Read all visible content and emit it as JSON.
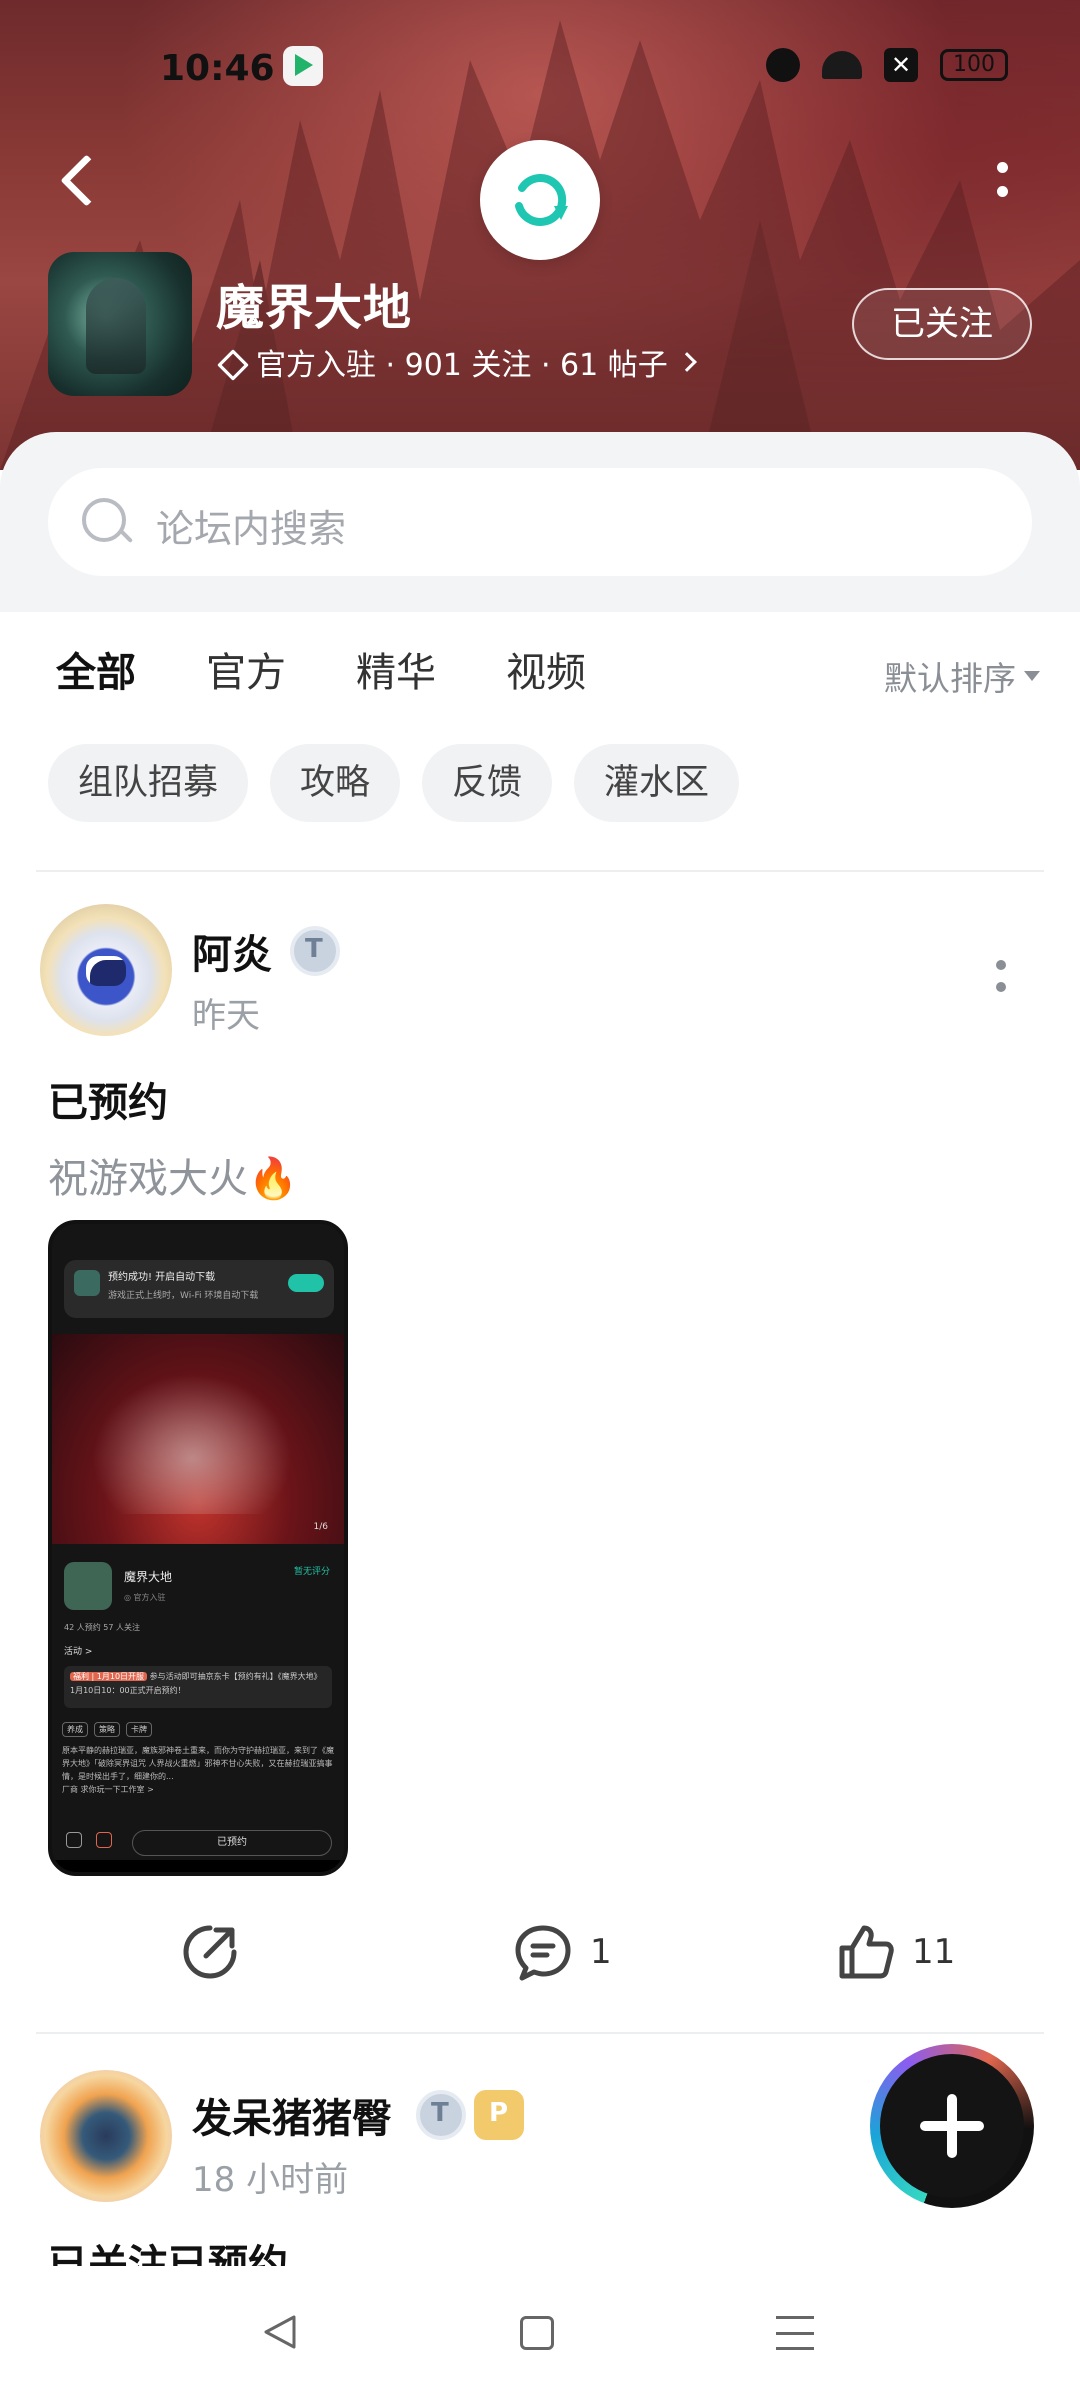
{
  "status_bar": {
    "time": "10:46",
    "battery": "100"
  },
  "forum": {
    "title": "魔界大地",
    "meta": "官方入驻 · 901 关注 · 61 帖子",
    "follow_label": "已关注"
  },
  "search": {
    "placeholder": "论坛内搜索"
  },
  "tabs": [
    {
      "label": "全部",
      "active": true
    },
    {
      "label": "官方"
    },
    {
      "label": "精华"
    },
    {
      "label": "视频"
    }
  ],
  "sort_label": "默认排序",
  "chips": [
    "组队招募",
    "攻略",
    "反馈",
    "灌水区"
  ],
  "posts": [
    {
      "author": "阿炎",
      "time": "昨天",
      "title": "已预约",
      "body": "祝游戏大火🔥",
      "comments": "1",
      "likes": "11",
      "screenshot": {
        "toast_title": "预约成功! 开启自动下载",
        "toast_sub": "游戏正式上线时，Wi-Fi 环境自动下载",
        "page_indicator": "1/6",
        "game_name": "魔界大地",
        "game_sub": "◎ 官方入驻",
        "score": "暂无评分",
        "stats": "42 人预约   57 人关注",
        "activity": "活动 >",
        "banner_tag": "福利 | 1月10日开服",
        "banner_text": "参与活动即可抽京东卡【预约有礼】《魔界大地》1月10日10：00正式开启预约！",
        "tags": [
          "养成",
          "策略",
          "卡牌"
        ],
        "desc": "原本平静的赫拉瑞亚，魔族邪神卷土重来，而你为守护赫拉瑞亚，来到了《魔界大地》「破除冥界诅咒 人界战火重燃」邪神不甘心失败，又在赫拉瑞亚搞事情，是时候出手了，细建你的...",
        "ad": "厂商  求你玩一下工作室 >",
        "reserved": "已预约"
      }
    },
    {
      "author": "发呆猪猪臀",
      "time": "18 小时前",
      "title": "已关注已预约"
    }
  ]
}
